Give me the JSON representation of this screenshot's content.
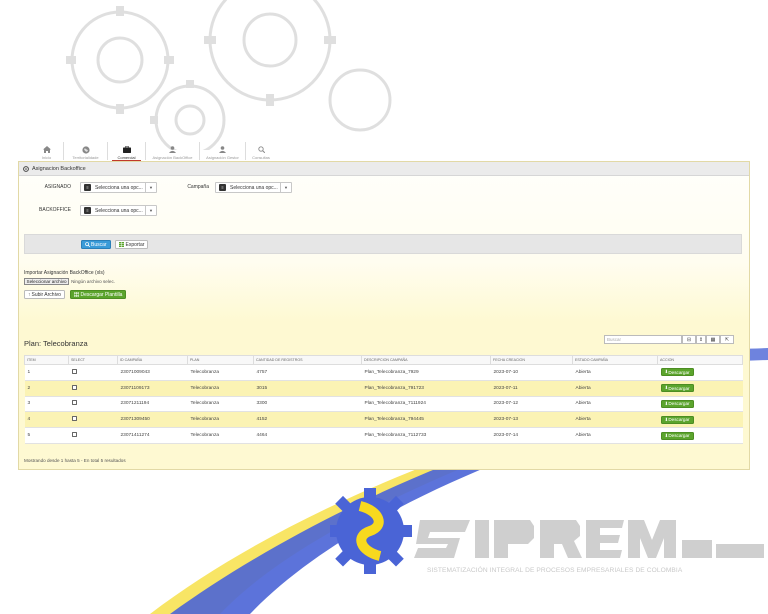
{
  "nav": {
    "items": [
      {
        "label": "Inicio",
        "icon": "home-icon",
        "active": false
      },
      {
        "label": "Territorialidade",
        "icon": "globe-icon",
        "active": false
      },
      {
        "label": "Comercial",
        "icon": "briefcase-icon",
        "active": true
      },
      {
        "label": "Asignación BackOffice",
        "icon": "user-icon",
        "active": false
      },
      {
        "label": "Asignación Gestor",
        "icon": "user-icon",
        "active": false
      },
      {
        "label": "Consultas",
        "icon": "search-icon",
        "active": false
      }
    ]
  },
  "panel": {
    "title": "Asignacion Backoffice"
  },
  "filters": {
    "asignado_label": "ASIGNADO",
    "asignado_value": "Selecciona una opc...",
    "campana_label": "Campaña",
    "campana_value": "Selecciona una opc...",
    "backoffice_label": "BACKOFFICE",
    "backoffice_value": "Selecciona una opc..."
  },
  "actions": {
    "buscar_label": "Buscar",
    "exportar_label": "Exportar"
  },
  "import": {
    "label": "Importar Asignación BackOffice (xls)",
    "file_button": "Seleccionar archivo",
    "file_status": "Ningún archivo selec.",
    "upload_label": "Subir Archivo",
    "template_label": "Descargar Plantilla"
  },
  "table": {
    "title": "Plan: Telecobranza",
    "search_placeholder": "Buscar",
    "columns": [
      "ITEM",
      "SELECT",
      "ID CAMPAÑA",
      "PLAN",
      "CANTIDAD DE REGISTROS",
      "DESCRIPCION CAMPAÑA",
      "FECHA CREACION",
      "ESTADO CAMPAÑA",
      "ACCION"
    ],
    "rows": [
      {
        "item": "1",
        "id": "23071009043",
        "plan": "Telecobranza",
        "cantidad": "4757",
        "descripcion": "Plan_Telecobranza_7929",
        "fecha": "2023-07-10",
        "estado": "Abierta",
        "accion": "Descargar"
      },
      {
        "item": "2",
        "id": "23071109173",
        "plan": "Telecobranza",
        "cantidad": "3015",
        "descripcion": "Plan_Telecobranza_791723",
        "fecha": "2023-07-11",
        "estado": "Abierta",
        "accion": "Descargar"
      },
      {
        "item": "3",
        "id": "23071211194",
        "plan": "Telecobranza",
        "cantidad": "3300",
        "descripcion": "Plan_Telecobranza_7111924",
        "fecha": "2023-07-12",
        "estado": "Abierta",
        "accion": "Descargar"
      },
      {
        "item": "4",
        "id": "23071309450",
        "plan": "Telecobranza",
        "cantidad": "4152",
        "descripcion": "Plan_Telecobranza_794445",
        "fecha": "2023-07-13",
        "estado": "Abierta",
        "accion": "Descargar"
      },
      {
        "item": "5",
        "id": "23071411274",
        "plan": "Telecobranza",
        "cantidad": "4464",
        "descripcion": "Plan_Telecobranza_7112733",
        "fecha": "2023-07-14",
        "estado": "Abierta",
        "accion": "Descargar"
      }
    ],
    "footer": "Mostrando desde 1 hasta 5 - En total 5 resultados"
  },
  "brand": {
    "tagline": "SISTEMATIZACIÓN INTEGRAL DE PROCESOS EMPRESARIALES DE COLOMBIA",
    "colors": {
      "blue": "#4a64d6",
      "yellow": "#f7d91e",
      "gray": "#cfcfcf"
    }
  }
}
